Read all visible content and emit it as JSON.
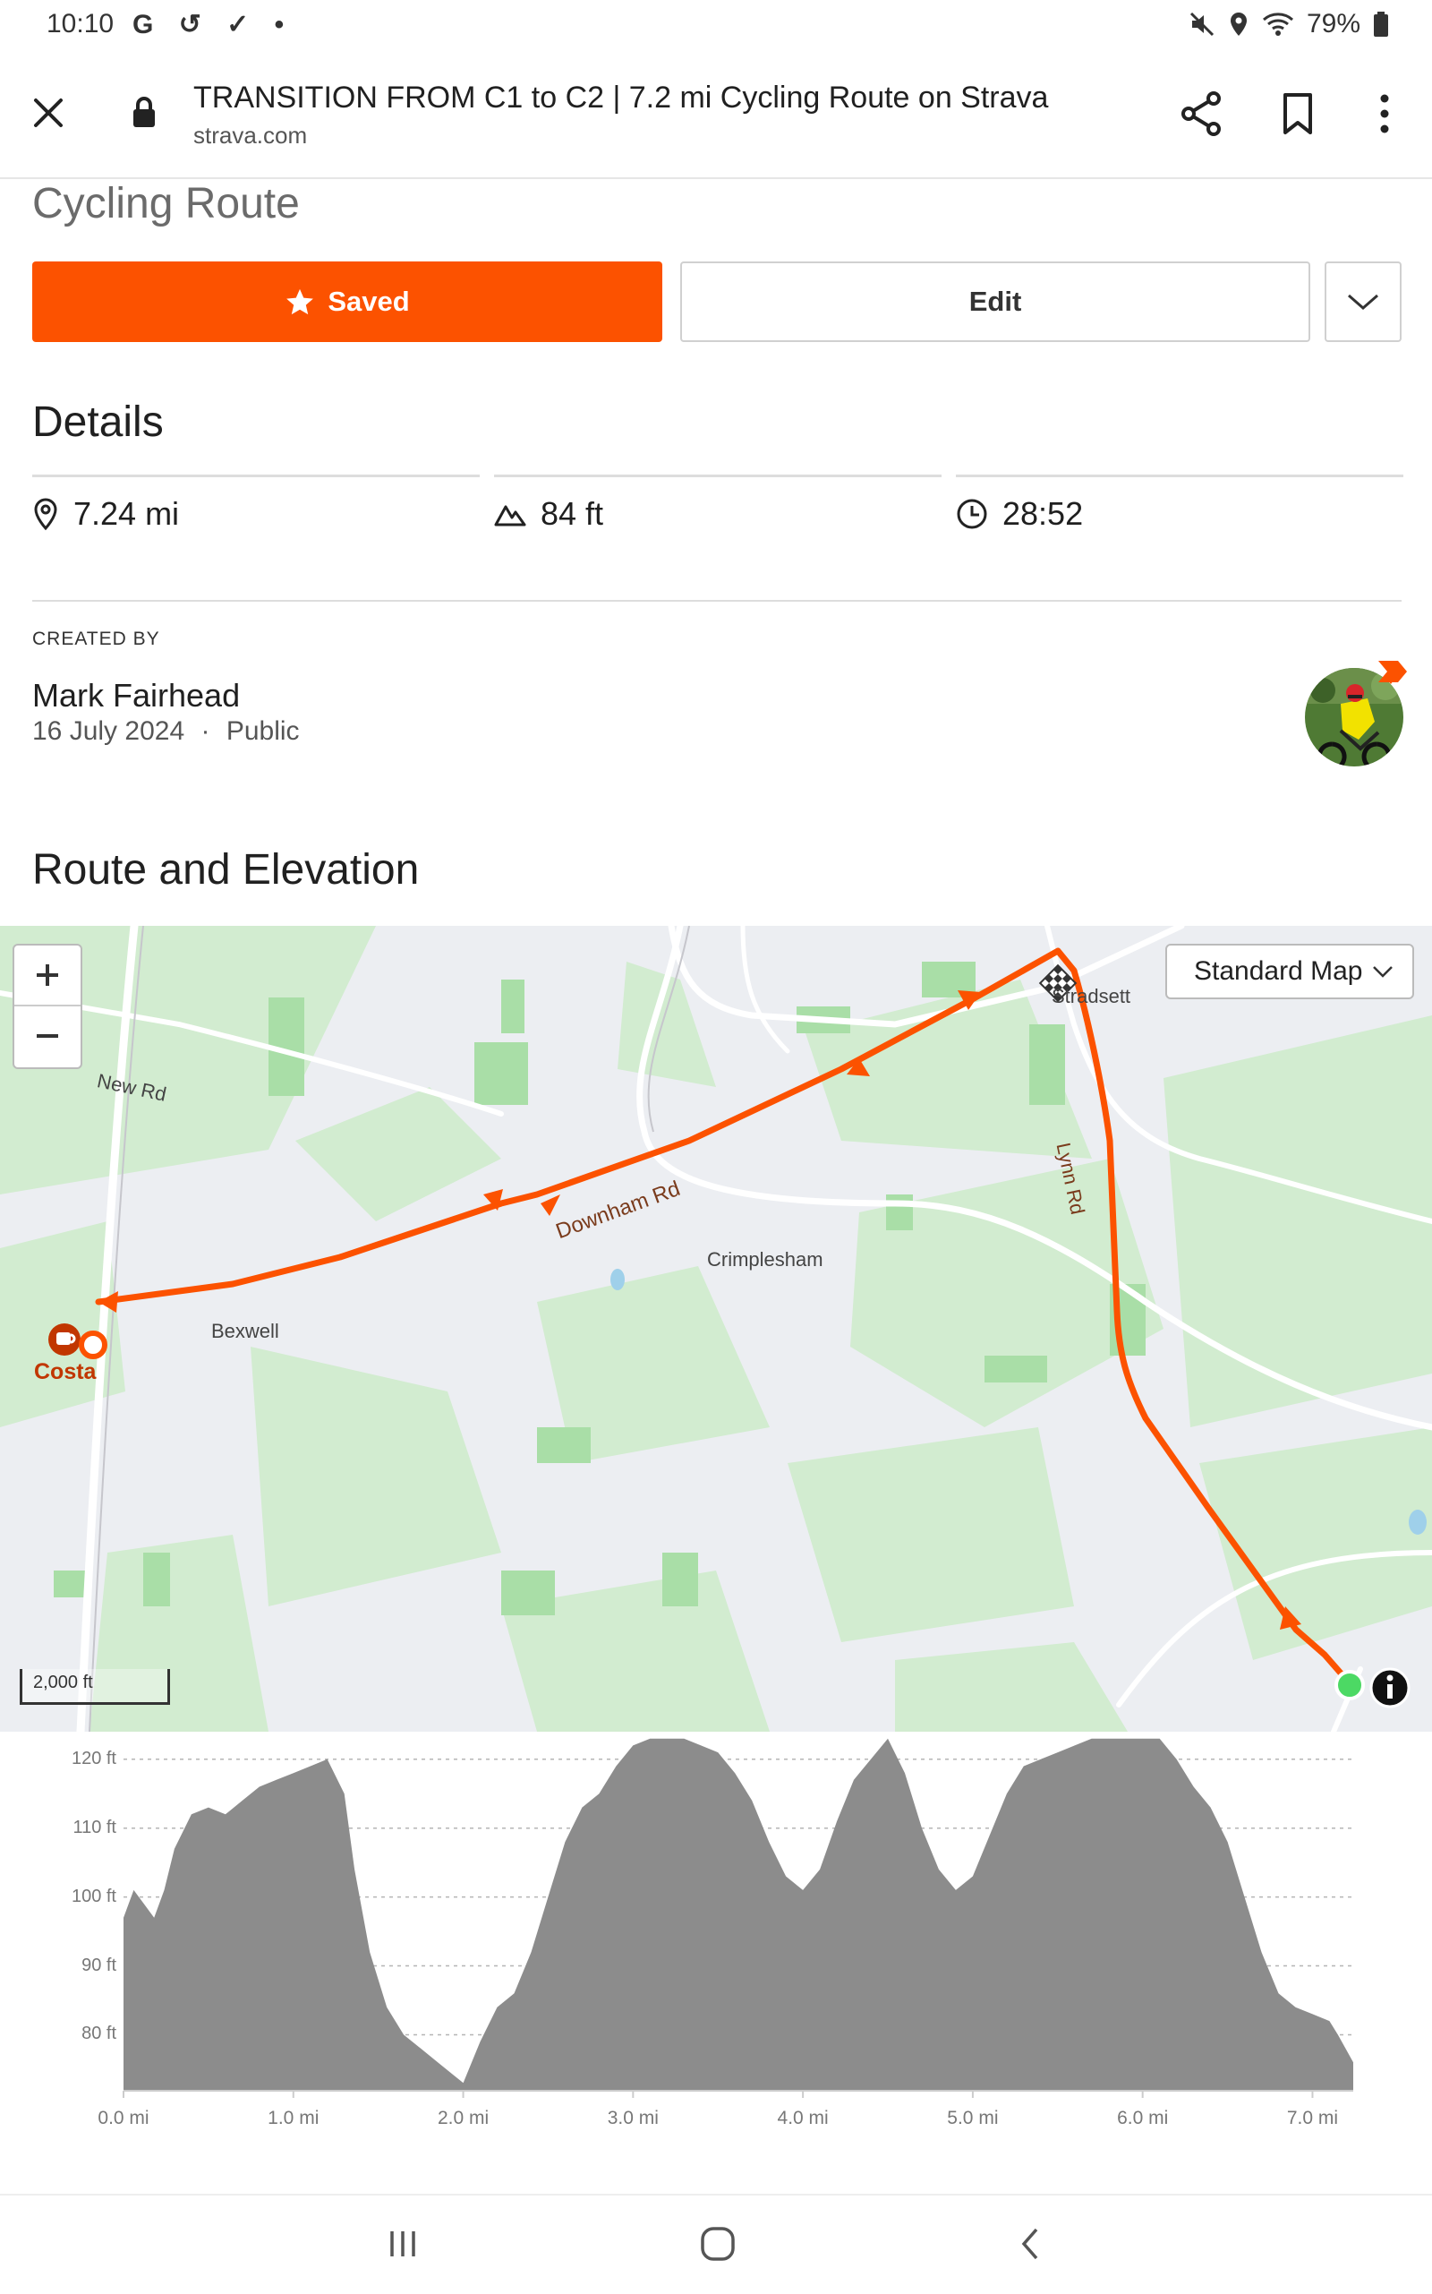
{
  "status_bar": {
    "time": "10:10",
    "left_icons": "G ↺ ✓ •",
    "battery": "79%"
  },
  "browser": {
    "title": "TRANSITION FROM C1 to C2 | 7.2 mi Cycling Route on Strava",
    "url": "strava.com"
  },
  "page": {
    "subtitle": "Cycling Route",
    "saved_label": "Saved",
    "edit_label": "Edit"
  },
  "details": {
    "heading": "Details",
    "distance": "7.24 mi",
    "elevation_gain": "84 ft",
    "moving_time": "28:52"
  },
  "creator": {
    "label": "CREATED BY",
    "name": "Mark Fairhead",
    "date": "16 July 2024",
    "visibility": "Public",
    "separator": "·"
  },
  "route_section": {
    "heading": "Route and Elevation"
  },
  "map": {
    "style_selector": "Standard Map",
    "scale": "2,000 ft",
    "labels": {
      "new_rd": "New Rd",
      "downham_rd": "Downham Rd",
      "bexwell": "Bexwell",
      "crimplesham": "Crimplesham",
      "stradsett": "Stradsett",
      "lynn_rd": "Lynn Rd",
      "costa": "Costa"
    },
    "colors": {
      "route": "#fc5200",
      "start": "#4cd964",
      "background": "#eceef2",
      "field": "#cfeccd"
    },
    "icons": [
      "plus-icon",
      "minus-icon",
      "chevron-down-icon",
      "checkered-flag-icon",
      "coffee-cup-icon",
      "info-icon"
    ]
  },
  "chart_data": {
    "type": "area",
    "title": "",
    "xlabel": "",
    "ylabel": "",
    "x_unit": "mi",
    "y_unit": "ft",
    "xlim": [
      0,
      7.24
    ],
    "ylim": [
      72,
      124
    ],
    "x_ticks": [
      "0.0 mi",
      "1.0 mi",
      "2.0 mi",
      "3.0 mi",
      "4.0 mi",
      "5.0 mi",
      "6.0 mi",
      "7.0 mi"
    ],
    "y_ticks": [
      "120 ft",
      "110 ft",
      "100 ft",
      "90 ft",
      "80 ft"
    ],
    "grid": true,
    "color": "#8c8c8c",
    "x": [
      0.0,
      0.06,
      0.12,
      0.18,
      0.24,
      0.3,
      0.4,
      0.5,
      0.6,
      0.7,
      0.8,
      0.9,
      1.0,
      1.1,
      1.2,
      1.3,
      1.36,
      1.45,
      1.55,
      1.65,
      1.75,
      1.85,
      1.95,
      2.0,
      2.1,
      2.2,
      2.3,
      2.4,
      2.5,
      2.6,
      2.7,
      2.8,
      2.9,
      3.0,
      3.1,
      3.2,
      3.3,
      3.4,
      3.5,
      3.6,
      3.7,
      3.8,
      3.9,
      4.0,
      4.1,
      4.2,
      4.3,
      4.4,
      4.5,
      4.6,
      4.7,
      4.8,
      4.9,
      5.0,
      5.1,
      5.2,
      5.3,
      5.4,
      5.5,
      5.6,
      5.7,
      5.8,
      5.9,
      6.0,
      6.1,
      6.2,
      6.3,
      6.4,
      6.5,
      6.6,
      6.7,
      6.8,
      6.9,
      7.0,
      7.1,
      7.15,
      7.24
    ],
    "y": [
      97,
      101,
      99,
      97,
      101,
      107,
      112,
      113,
      112,
      114,
      116,
      117,
      118,
      119,
      120,
      115,
      104,
      92,
      84,
      80,
      78,
      76,
      74,
      73,
      79,
      84,
      86,
      92,
      100,
      108,
      113,
      115,
      119,
      122,
      123,
      123,
      123,
      122,
      121,
      118,
      114,
      108,
      103,
      101,
      104,
      111,
      117,
      120,
      123,
      118,
      110,
      104,
      101,
      103,
      109,
      115,
      119,
      120,
      121,
      122,
      123,
      123,
      123,
      123,
      123,
      120,
      116,
      113,
      108,
      100,
      92,
      86,
      84,
      83,
      82,
      80,
      76
    ]
  }
}
